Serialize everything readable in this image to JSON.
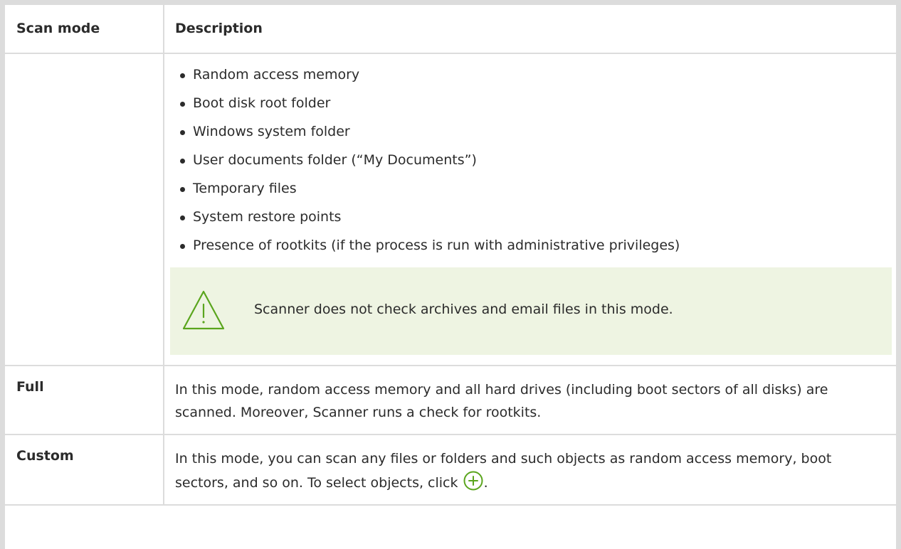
{
  "table": {
    "headers": [
      "Scan mode",
      "Description"
    ],
    "express": {
      "mode": "",
      "bullets": [
        "Random access memory",
        "Boot disk root folder",
        "Windows system folder",
        "User documents folder (“My Documents”)",
        "Temporary files",
        "System restore points",
        "Presence of rootkits (if the process is run with administrative privileges)"
      ],
      "warning": "Scanner does not check archives and email files in this mode.",
      "warning_icon": "warning-triangle-icon"
    },
    "full": {
      "mode": "Full",
      "description": "In this mode, random access memory and all hard drives (including boot sectors of all disks) are scanned. Moreover, Scanner runs a check for rootkits."
    },
    "custom": {
      "mode": "Custom",
      "description_before": "In this mode, you can scan any files or folders and such objects as random access memory, boot sectors, and so on. To select objects, click",
      "description_after": ".",
      "icon": "add-circle-icon"
    }
  },
  "colors": {
    "accent_green": "#5aa51d",
    "warning_bg": "#eef4e2",
    "border": "#dcdcdc",
    "text": "#2b2b2b"
  }
}
